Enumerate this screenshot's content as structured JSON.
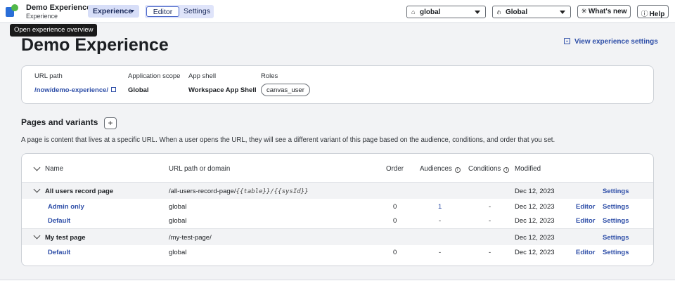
{
  "topbar": {
    "app_title": "Demo Experience",
    "app_subtitle": "Experience",
    "experience_menu": "Experience",
    "mode_editor": "Editor",
    "mode_settings": "Settings",
    "scope_select": "global",
    "app_select": "Global",
    "whats_new": "What's new",
    "help": "Help"
  },
  "tooltip": "Open experience overview",
  "page": {
    "title": "Demo Experience",
    "view_settings": "View experience settings"
  },
  "info": {
    "url_label": "URL path",
    "url_value": "/now/demo-experience/",
    "scope_label": "Application scope",
    "scope_value": "Global",
    "shell_label": "App shell",
    "shell_value": "Workspace App Shell",
    "roles_label": "Roles",
    "role": "canvas_user"
  },
  "pages": {
    "title": "Pages and variants",
    "description": "A page is content that lives at a specific URL. When a user opens the URL, they will see a different variant of this page based on the audience, conditions, and order that you set.",
    "columns": {
      "name": "Name",
      "url": "URL path or domain",
      "order": "Order",
      "audiences": "Audiences",
      "conditions": "Conditions",
      "modified": "Modified"
    },
    "groups": [
      {
        "name": "All users record page",
        "url_prefix": "/all-users-record-page/",
        "url_params": "{{table}}/{{sysId}}",
        "modified": "Dec 12, 2023",
        "settings": "Settings",
        "variants": [
          {
            "name": "Admin only",
            "url": "global",
            "order": "0",
            "audiences": "1",
            "conditions": "-",
            "modified": "Dec 12, 2023",
            "editor": "Editor",
            "settings": "Settings"
          },
          {
            "name": "Default",
            "url": "global",
            "order": "0",
            "audiences": "-",
            "conditions": "-",
            "modified": "Dec 12, 2023",
            "editor": "Editor",
            "settings": "Settings"
          }
        ]
      },
      {
        "name": "My test page",
        "url_prefix": "/my-test-page/",
        "url_params": "",
        "modified": "Dec 12, 2023",
        "settings": "Settings",
        "variants": [
          {
            "name": "Default",
            "url": "global",
            "order": "0",
            "audiences": "-",
            "conditions": "-",
            "modified": "Dec 12, 2023",
            "editor": "Editor",
            "settings": "Settings"
          }
        ]
      }
    ]
  }
}
